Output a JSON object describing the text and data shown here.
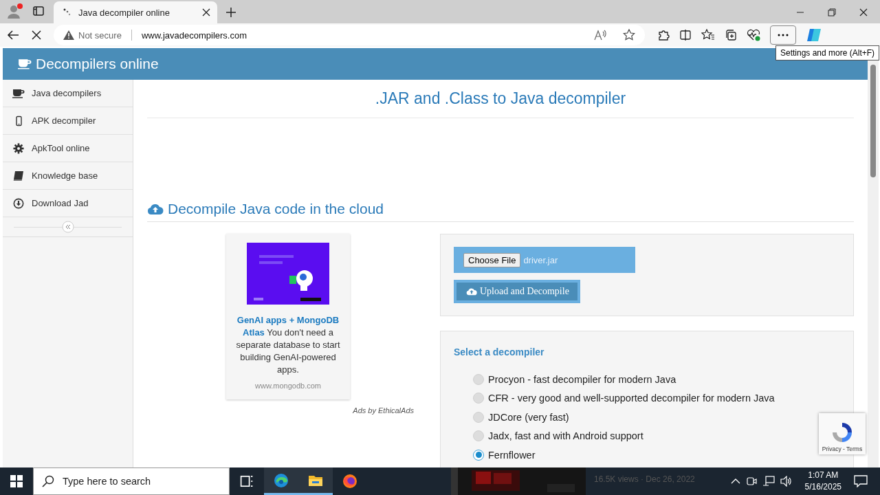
{
  "browser": {
    "tabs": [
      {
        "title": "Java decompiler online",
        "selected": true
      }
    ],
    "address": {
      "security": "Not secure",
      "url": "www.javadecompilers.com"
    },
    "tooltip": "Settings and more (Alt+F)"
  },
  "page": {
    "brand": "Decompilers online",
    "sidebar": {
      "items": [
        {
          "label": "Java decompilers",
          "kind": "cup"
        },
        {
          "label": "APK decompiler",
          "kind": "phone"
        },
        {
          "label": "ApkTool online",
          "kind": "gear"
        },
        {
          "label": "Knowledge base",
          "kind": "book"
        },
        {
          "label": "Download Jad",
          "kind": "download"
        }
      ]
    },
    "title": ".JAR and .Class to Java decompiler",
    "section_heading": "Decompile Java code in the cloud",
    "ad": {
      "text": "**GenAI apps + MongoDB Atlas** You don't need a separate database to start building GenAI-powered apps.",
      "domain": "www.mongodb.com",
      "credit": "Ads by EthicalAds"
    },
    "upload": {
      "choose_button": "Choose File",
      "file_name": "driver.jar",
      "submit_button": "Upload and Decompile"
    },
    "decompilers": {
      "heading": "Select a decompiler",
      "options": [
        {
          "label": "Procyon - fast decompiler for modern Java",
          "selected": false
        },
        {
          "label": "CFR - very good and well-supported decompiler for modern Java",
          "selected": false
        },
        {
          "label": "JDCore (very fast)",
          "selected": false
        },
        {
          "label": "Jadx, fast and with Android support",
          "selected": false
        },
        {
          "label": "Fernflower",
          "selected": true
        }
      ]
    },
    "recaptcha": {
      "links": "Privacy - Terms"
    }
  },
  "taskbar": {
    "search_placeholder": "Type here to search",
    "apps": [
      {
        "kind": "taskview",
        "running": false
      },
      {
        "kind": "edge",
        "running": true
      },
      {
        "kind": "explorer",
        "running": true
      },
      {
        "kind": "firefox",
        "running": false
      }
    ],
    "preview": {
      "meta": "16.5K views · Dec 26, 2022"
    },
    "clock": {
      "time": "1:07 AM",
      "date": "5/16/2025"
    }
  }
}
